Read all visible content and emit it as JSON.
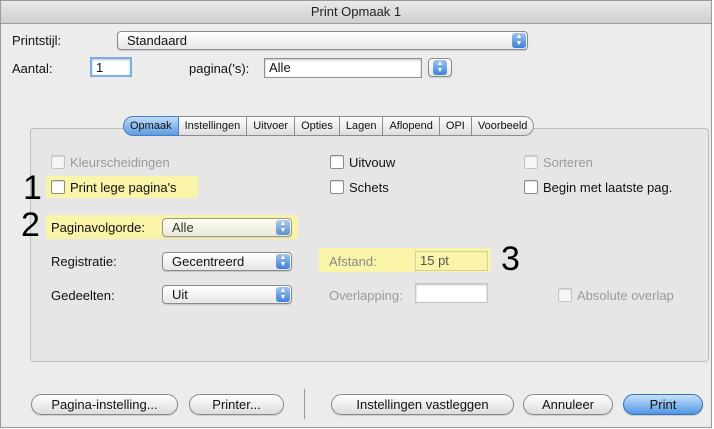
{
  "window": {
    "title": "Print Opmaak 1"
  },
  "printstijl": {
    "label": "Printstijl:",
    "value": "Standaard"
  },
  "aantal": {
    "label": "Aantal:",
    "value": "1"
  },
  "paginas": {
    "label": "pagina('s):",
    "value": "Alle"
  },
  "tabs": [
    {
      "label": "Opmaak",
      "active": true
    },
    {
      "label": "Instellingen",
      "active": false
    },
    {
      "label": "Uitvoer",
      "active": false
    },
    {
      "label": "Opties",
      "active": false
    },
    {
      "label": "Lagen",
      "active": false
    },
    {
      "label": "Aflopend",
      "active": false
    },
    {
      "label": "OPI",
      "active": false
    },
    {
      "label": "Voorbeeld",
      "active": false
    }
  ],
  "checkboxes": {
    "kleurscheidingen": {
      "label": "Kleurscheidingen",
      "enabled": false,
      "checked": false
    },
    "uitvouw": {
      "label": "Uitvouw",
      "enabled": true,
      "checked": false
    },
    "sorteren": {
      "label": "Sorteren",
      "enabled": false,
      "checked": false
    },
    "print_lege": {
      "label": "Print lege pagina's",
      "enabled": true,
      "checked": false
    },
    "schets": {
      "label": "Schets",
      "enabled": true,
      "checked": false
    },
    "begin_laatste": {
      "label": "Begin met laatste pag.",
      "enabled": true,
      "checked": false
    },
    "absolute_overlap": {
      "label": "Absolute overlap",
      "enabled": false,
      "checked": false
    }
  },
  "paginavolgorde": {
    "label": "Paginavolgorde:",
    "value": "Alle"
  },
  "registratie": {
    "label": "Registratie:",
    "value": "Gecentreerd"
  },
  "gedeelten": {
    "label": "Gedeelten:",
    "value": "Uit"
  },
  "afstand": {
    "label": "Afstand:",
    "value": "15 pt"
  },
  "overlapping": {
    "label": "Overlapping:",
    "value": ""
  },
  "annotations": {
    "n1": "1",
    "n2": "2",
    "n3": "3"
  },
  "buttons": {
    "pagina_instelling": "Pagina-instelling...",
    "printer": "Printer...",
    "instellingen_vastleggen": "Instellingen vastleggen",
    "annuleer": "Annuleer",
    "print": "Print"
  },
  "colors": {
    "highlight": "#fdf69c",
    "accent": "#4f96e6"
  }
}
